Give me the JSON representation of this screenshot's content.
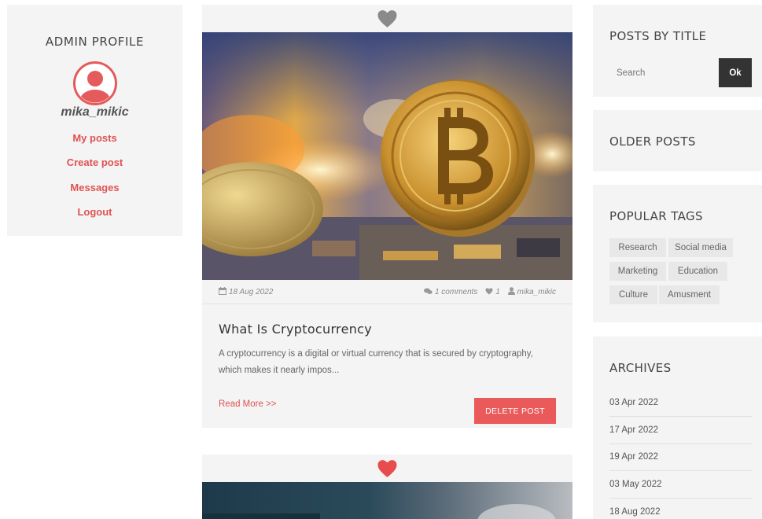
{
  "profile": {
    "title": "ADMIN PROFILE",
    "username": "mika_mikic",
    "links": [
      "My posts",
      "Create post",
      "Messages",
      "Logout"
    ]
  },
  "posts": [
    {
      "date": "18 Aug 2022",
      "comments": "1 comments",
      "likes": "1",
      "author": "mika_mikic",
      "title": "What Is Cryptocurrency",
      "excerpt": "A cryptocurrency is a digital or virtual currency that is secured by cryptography, which makes it nearly impos...",
      "read_more": "Read More >>",
      "delete_label": "DELETE POST",
      "liked": false
    },
    {
      "liked": true
    }
  ],
  "sidebar": {
    "search_title": "POSTS BY TITLE",
    "search_placeholder": "Search",
    "ok_label": "Ok",
    "older_title": "OLDER POSTS",
    "tags_title": "POPULAR TAGS",
    "tags": [
      "Research",
      "Social media",
      "Marketing",
      "Education",
      "Culture",
      "Amusment"
    ],
    "archives_title": "ARCHIVES",
    "archives": [
      "03 Apr 2022",
      "17 Apr 2022",
      "19 Apr 2022",
      "03 May 2022",
      "18 Aug 2022"
    ]
  },
  "colors": {
    "accent": "#ea5a5a",
    "panel": "#f4f4f4",
    "heart_inactive": "#8a8a8a",
    "heart_active": "#e84c4c",
    "ok_button": "#333333"
  }
}
